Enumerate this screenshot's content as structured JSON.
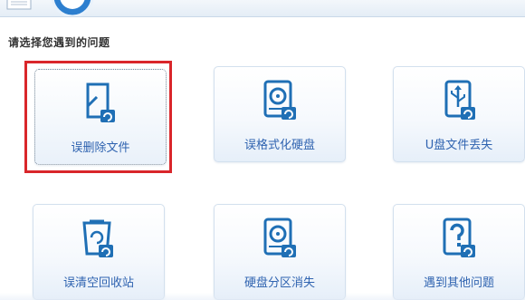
{
  "prompt": "请选择您遇到的问题",
  "tiles": [
    {
      "label": "误删除文件",
      "icon": "deleted-file-icon"
    },
    {
      "label": "误格式化硬盘",
      "icon": "formatted-disk-icon"
    },
    {
      "label": "U盘文件丢失",
      "icon": "usb-file-icon"
    },
    {
      "label": "误清空回收站",
      "icon": "recycle-bin-icon"
    },
    {
      "label": "硬盘分区消失",
      "icon": "lost-partition-icon"
    },
    {
      "label": "遇到其他问题",
      "icon": "question-icon"
    }
  ],
  "selected_tile": "误删除文件",
  "colors": {
    "accent": "#1f6fb5",
    "label": "#2f63b0",
    "selection": "#d9262b"
  }
}
